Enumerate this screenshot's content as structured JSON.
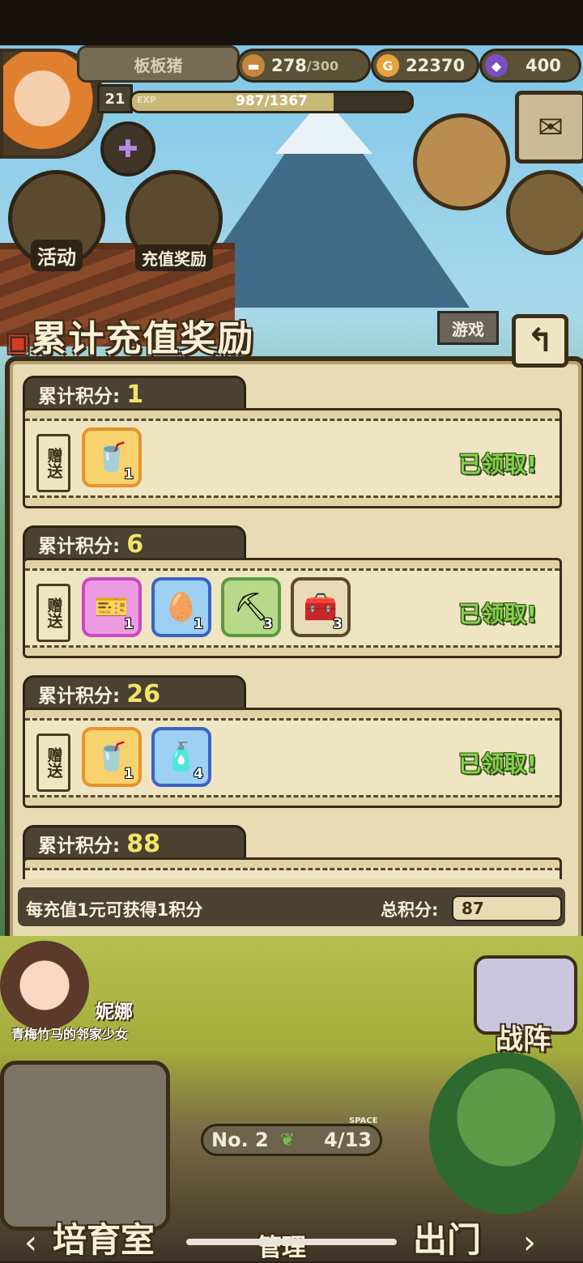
{
  "player": {
    "name": "板板猪",
    "level": "21",
    "exp_label": "EXP",
    "exp_text": "987/1367",
    "exp_fraction": 0.722
  },
  "resources": {
    "energy": "278",
    "energy_max": "/300",
    "gold": "22370",
    "gems": "400"
  },
  "quick_icons": {
    "activity": "活动",
    "recharge_reward": "充值奖励",
    "game_tab": "游戏"
  },
  "panel": {
    "title": "累计充值奖励",
    "back_icon": "↰",
    "tiers": [
      {
        "label": "累计积分:",
        "points": "1",
        "gift_label": "赠送",
        "status": "已领取!",
        "items": [
          {
            "icon": "potion-icon",
            "glyph": "🥤",
            "count": "1",
            "frame": "orange"
          }
        ]
      },
      {
        "label": "累计积分:",
        "points": "6",
        "gift_label": "赠送",
        "status": "已领取!",
        "items": [
          {
            "icon": "ticket-icon",
            "glyph": "🎫",
            "count": "1",
            "frame": "pink"
          },
          {
            "icon": "egg-icon",
            "glyph": "🥚",
            "count": "1",
            "frame": "blue"
          },
          {
            "icon": "pickaxe-icon",
            "glyph": "⛏",
            "count": "3",
            "frame": "green"
          },
          {
            "icon": "chest-icon",
            "glyph": "🧰",
            "count": "3",
            "frame": "beige"
          }
        ]
      },
      {
        "label": "累计积分:",
        "points": "26",
        "gift_label": "赠送",
        "status": "已领取!",
        "items": [
          {
            "icon": "potion-icon",
            "glyph": "🥤",
            "count": "1",
            "frame": "orange"
          },
          {
            "icon": "spray-bottle-icon",
            "glyph": "🧴",
            "count": "4",
            "frame": "blue"
          }
        ]
      },
      {
        "label": "累计积分:",
        "points": "88",
        "gift_label": "",
        "status": "",
        "items": []
      }
    ],
    "footer_note": "每充值1元可获得1积分",
    "total_label": "总积分:",
    "total_value": "87"
  },
  "bottom": {
    "character_name": "妮娜",
    "character_desc": "青梅竹马的邻家少女",
    "team_label": "战阵",
    "room_no": "No. 2",
    "space_label": "SPACE",
    "space_value": "4/13",
    "nav_left": "培育室",
    "nav_mid": "管理",
    "nav_right": "出门"
  },
  "colors": {
    "claimed_green": "#86d04a",
    "points_yellow": "#f4e36a",
    "panel_bg": "#e9dcb4"
  }
}
